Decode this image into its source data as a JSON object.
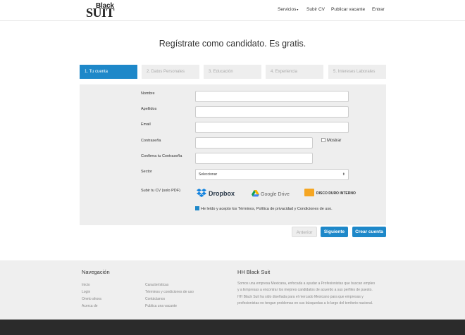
{
  "header": {
    "logo_top": "Black",
    "logo_bottom": "SUIT",
    "nav": [
      "Servicios",
      "Subir CV",
      "Publicar vacante",
      "Entrar"
    ]
  },
  "title": "Regístrate como candidato. Es gratis.",
  "steps": [
    "1. Tu cuenta",
    "2. Datos Personales",
    "3. Educación",
    "4. Experiencia",
    "5. Intereses Laborales"
  ],
  "form": {
    "labels": [
      "Nombre",
      "Apellidos",
      "Email",
      "Contraseña",
      "Confirma tu Contraseña",
      "Sector"
    ],
    "show_label": "Mostrar",
    "sector_value": "Seleccionar",
    "cv_label": "Subir tu CV (solo PDF)",
    "dropbox": "Dropbox",
    "gdrive": "Google Drive",
    "hdd": "DISCO DURO INTERNO",
    "terms": "He leído y acepto los Términos, Política de privacidad y Condiciones de uso."
  },
  "buttons": {
    "prev": "Anterior",
    "next": "Siguiente",
    "create": "Crear cuenta"
  },
  "footer": {
    "nav_title": "Navegación",
    "links_col1": [
      "Inicio",
      "Login",
      "Oneto ahora",
      "Acerca de"
    ],
    "links_col2": [
      "Características",
      "Términos y condiciones de uso",
      "Contáctanos",
      "Publica una vacante"
    ],
    "about_title": "HH Black Suit",
    "about_lines": [
      "Somos una empresa Mexicana, enfocada a ayudar a Profesionistas que buscan empleo",
      "y a Empresas a encontrar los mejores candidatos de acuerdo a sus perfiles de puesto.",
      "HH Black Suit ha sido diseñada para el mercado Mexicano para que empresas y",
      "profesionistas no tengan problemas en sus búsquedas a lo largo del territorio nacional."
    ]
  },
  "colors": {
    "primary": "#1e88c9",
    "panel": "#eeeeee",
    "footer": "#efefef",
    "bottombar": "#2b2b2b"
  }
}
